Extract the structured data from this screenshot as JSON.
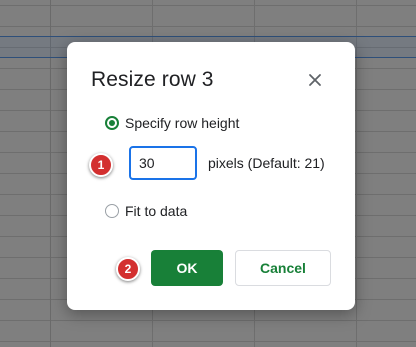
{
  "dialog": {
    "title": "Resize row 3",
    "close_icon": "close-icon",
    "option_specify": {
      "label": "Specify row height",
      "selected": true
    },
    "height_input": {
      "value": "30"
    },
    "pixels_hint": "pixels (Default: 21)",
    "option_fit": {
      "label": "Fit to data",
      "selected": false
    },
    "ok_label": "OK",
    "cancel_label": "Cancel"
  },
  "annotations": {
    "step1": "1",
    "step2": "2"
  },
  "colors": {
    "accent_green": "#188038",
    "focus_blue": "#1a73e8",
    "badge_red": "#d32f2f"
  }
}
